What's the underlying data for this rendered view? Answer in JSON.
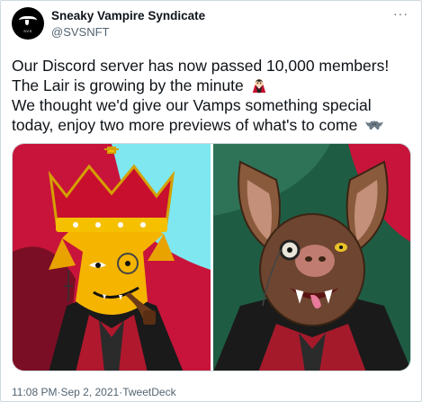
{
  "header": {
    "display_name": "Sneaky Vampire Syndicate",
    "handle": "@SVSNFT",
    "avatar_text": "SVS",
    "more_label": "···"
  },
  "tweet": {
    "lines": [
      "Our Discord server has now passed 10,000 members!",
      "The Lair is growing by the minute",
      "We thought we'd give our Vamps something special",
      "today, enjoy two more previews of what's to come"
    ],
    "emoji": [
      "vampire-emoji",
      "bat-emoji"
    ]
  },
  "media": {
    "images": [
      {
        "name": "vampire-king-preview",
        "subject": "crowned vampire with pipe and monocle"
      },
      {
        "name": "bat-vampire-preview",
        "subject": "bat vampire with monocle"
      }
    ]
  },
  "footer": {
    "time": "11:08 PM",
    "separator": " · ",
    "date": "Sep 2, 2021",
    "source": "TweetDeck"
  },
  "colors": {
    "text": "#0f1419",
    "muted": "#536471",
    "border": "#cfd9de"
  }
}
